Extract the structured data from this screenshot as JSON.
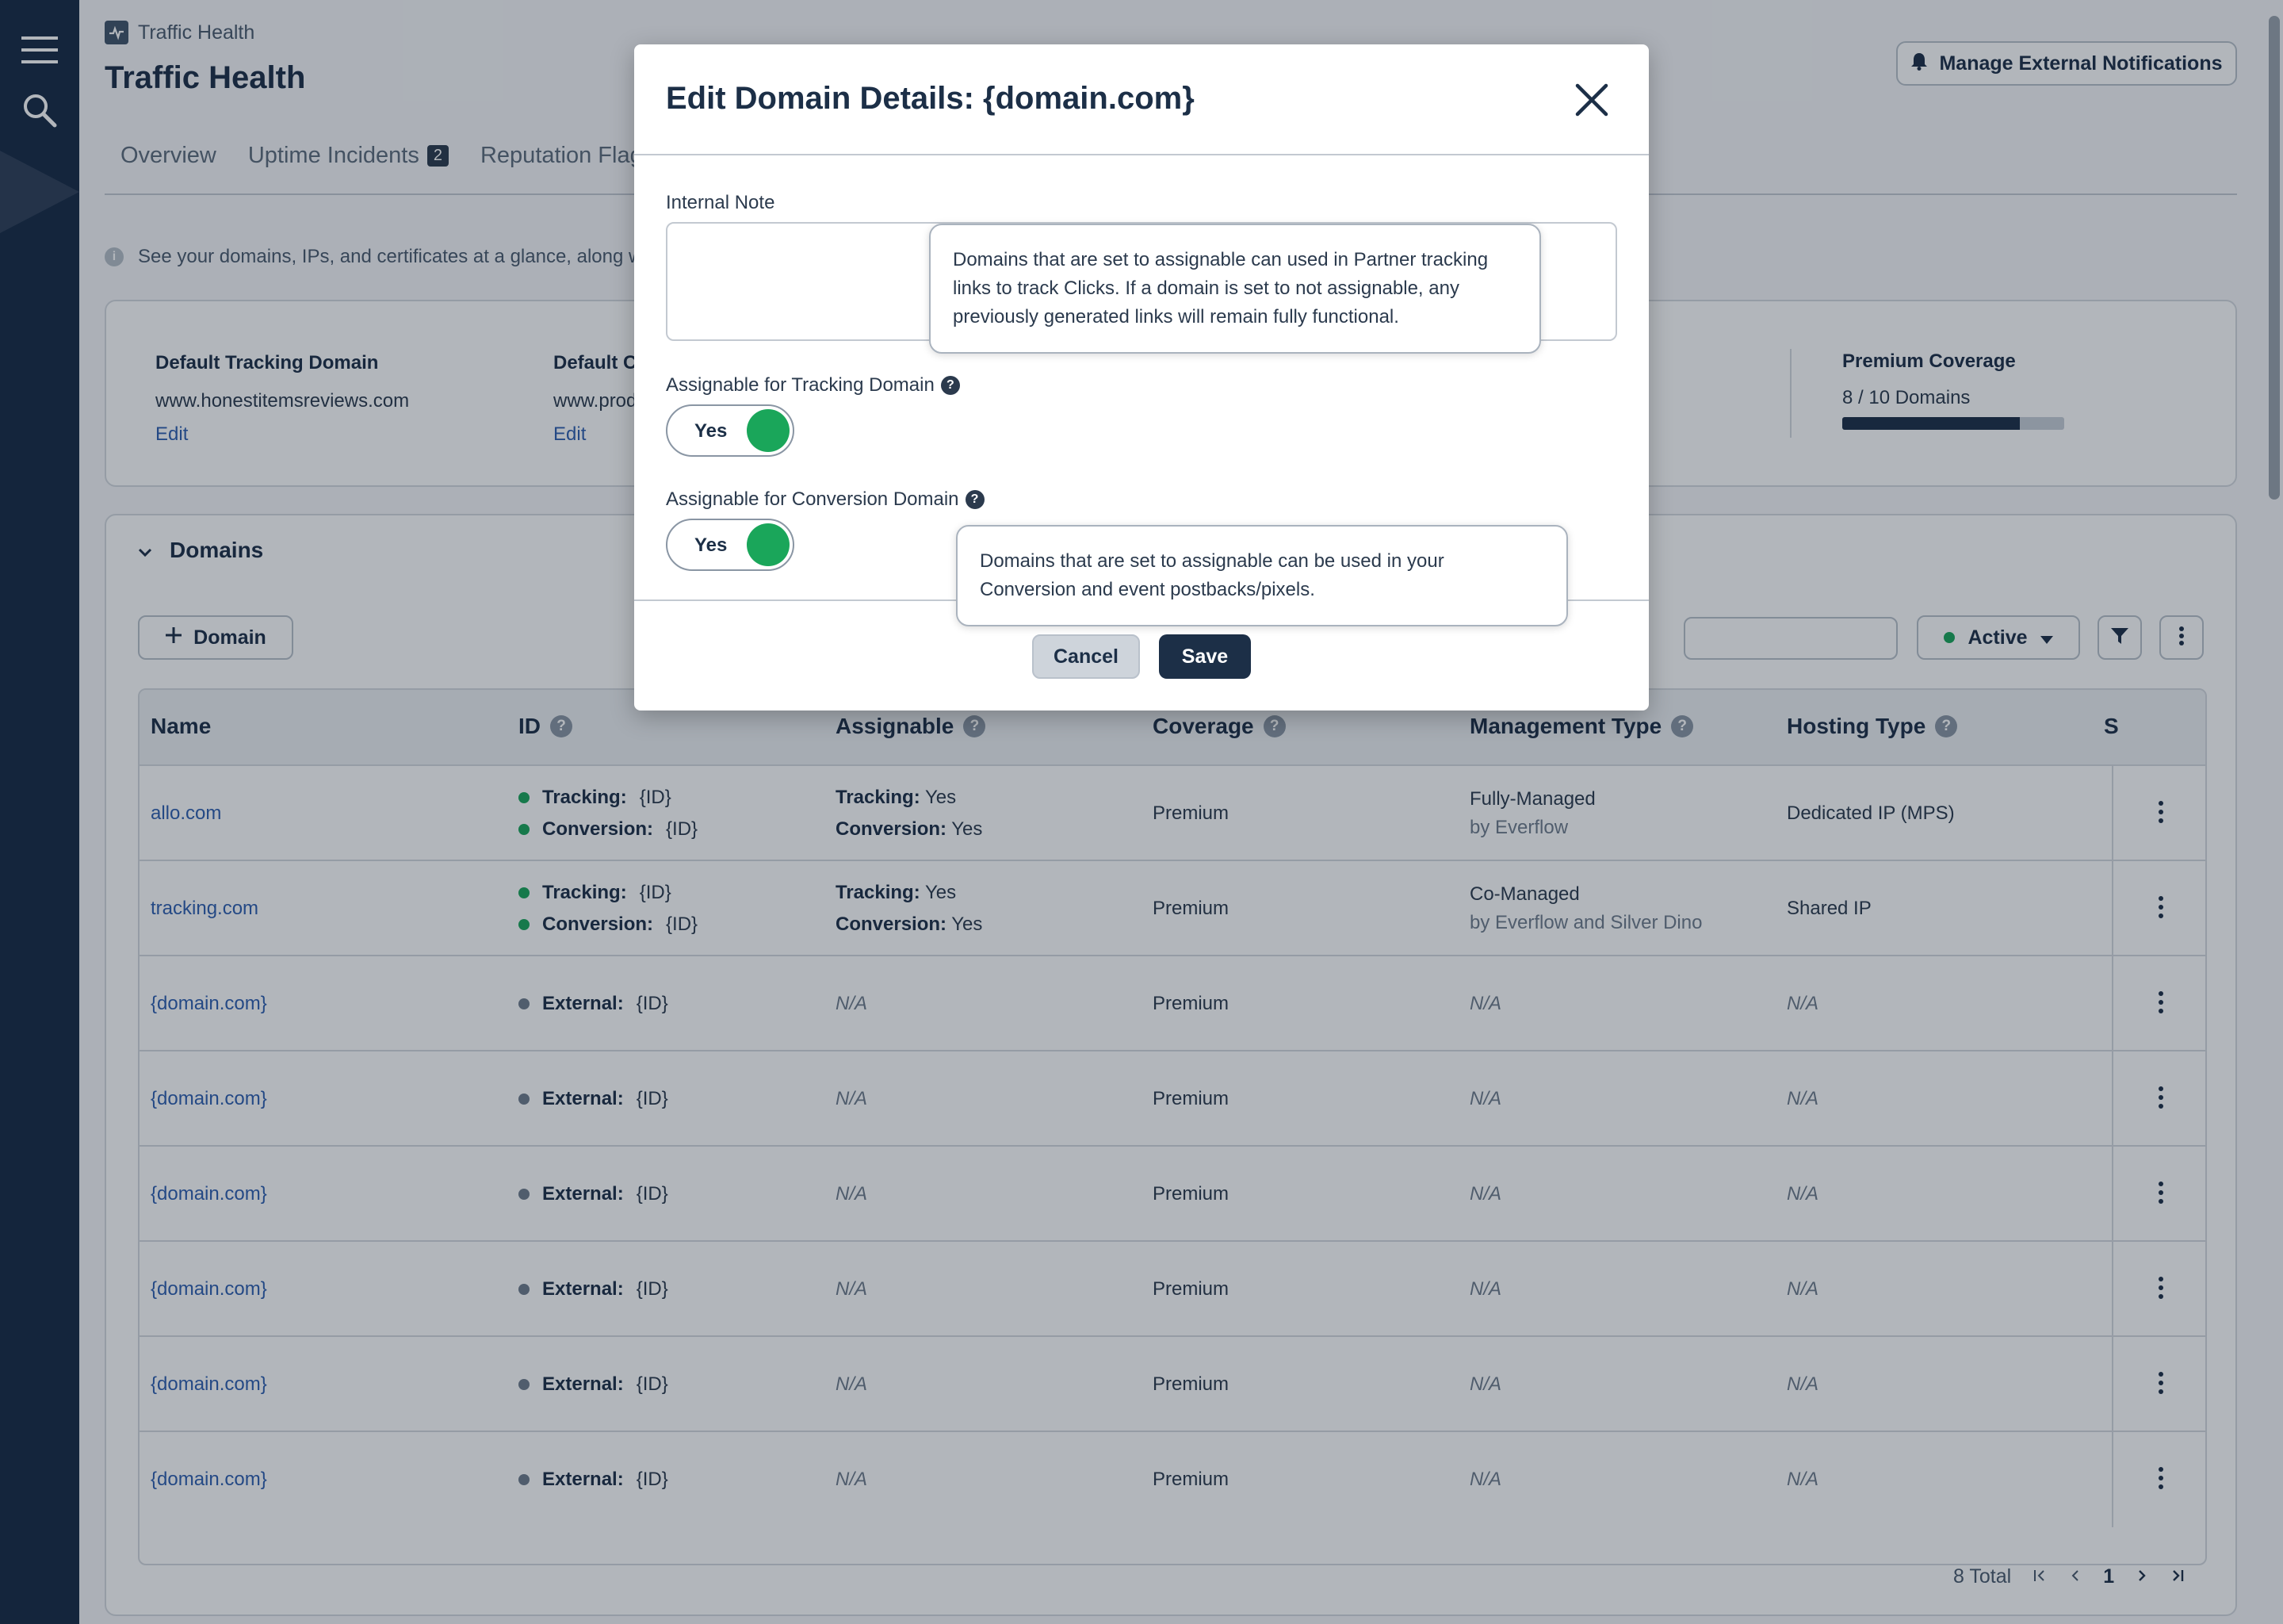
{
  "app": {
    "breadcrumb": "Traffic Health",
    "title": "Traffic Health",
    "manage_notifications": "Manage External Notifications"
  },
  "tabs": [
    {
      "label": "Overview"
    },
    {
      "label": "Uptime Incidents",
      "badge": "2"
    },
    {
      "label": "Reputation Flags"
    }
  ],
  "info_text": "See your domains, IPs, and certificates at a glance, along wit",
  "summary": {
    "tracking": {
      "label": "Default Tracking Domain",
      "value": "www.honestitemsreviews.com",
      "edit": "Edit"
    },
    "conversion": {
      "label": "Default Co",
      "value": "www.prod",
      "edit": "Edit"
    },
    "coverage": {
      "label": "Premium Coverage",
      "value": "8 / 10 Domains",
      "used": 8,
      "total": 10
    }
  },
  "domains": {
    "title": "Domains",
    "add_button": "Domain",
    "status_filter": "Active",
    "columns": [
      "Name",
      "ID",
      "Assignable",
      "Coverage",
      "Management Type",
      "Hosting Type",
      "S"
    ],
    "rows": [
      {
        "name": "allo.com",
        "id1_label": "Tracking:",
        "id1": "{ID}",
        "id2_label": "Conversion:",
        "id2": "{ID}",
        "assign1_label": "Tracking:",
        "assign1": "Yes",
        "assign2_label": "Conversion:",
        "assign2": "Yes",
        "coverage": "Premium",
        "mgmt": "Fully-Managed",
        "mgmt_sub": "by Everflow",
        "hosting": "Dedicated IP (MPS)"
      },
      {
        "name": "tracking.com",
        "id1_label": "Tracking:",
        "id1": "{ID}",
        "id2_label": "Conversion:",
        "id2": "{ID}",
        "assign1_label": "Tracking:",
        "assign1": "Yes",
        "assign2_label": "Conversion:",
        "assign2": "Yes",
        "coverage": "Premium",
        "mgmt": "Co-Managed",
        "mgmt_sub": "by Everflow and Silver Dino",
        "hosting": "Shared IP"
      },
      {
        "name": "{domain.com}",
        "ext_label": "External:",
        "ext": "{ID}",
        "assign": "N/A",
        "coverage": "Premium",
        "mgmt": "N/A",
        "hosting": "N/A"
      },
      {
        "name": "{domain.com}",
        "ext_label": "External:",
        "ext": "{ID}",
        "assign": "N/A",
        "coverage": "Premium",
        "mgmt": "N/A",
        "hosting": "N/A"
      },
      {
        "name": "{domain.com}",
        "ext_label": "External:",
        "ext": "{ID}",
        "assign": "N/A",
        "coverage": "Premium",
        "mgmt": "N/A",
        "hosting": "N/A"
      },
      {
        "name": "{domain.com}",
        "ext_label": "External:",
        "ext": "{ID}",
        "assign": "N/A",
        "coverage": "Premium",
        "mgmt": "N/A",
        "hosting": "N/A"
      },
      {
        "name": "{domain.com}",
        "ext_label": "External:",
        "ext": "{ID}",
        "assign": "N/A",
        "coverage": "Premium",
        "mgmt": "N/A",
        "hosting": "N/A"
      },
      {
        "name": "{domain.com}",
        "ext_label": "External:",
        "ext": "{ID}",
        "assign": "N/A",
        "coverage": "Premium",
        "mgmt": "N/A",
        "hosting": "N/A"
      }
    ],
    "total": "8 Total",
    "page": "1"
  },
  "modal": {
    "title": "Edit Domain Details: {domain.com}",
    "note_label": "Internal Note",
    "tracking_label": "Assignable for Tracking Domain",
    "tracking_value": "Yes",
    "conversion_label": "Assignable for Conversion Domain",
    "conversion_value": "Yes",
    "tooltip_tracking": "Domains that are set to assignable can used in Partner tracking links to track Clicks. If a domain is set to not assignable, any previously generated links will remain fully functional.",
    "tooltip_conversion": "Domains that are set to assignable can be used in your Conversion and event postbacks/pixels.",
    "cancel": "Cancel",
    "save": "Save"
  },
  "colors": {
    "sidebar": "#172a45",
    "primary": "#1c2f47",
    "link": "#2f5fb0",
    "success": "#1aa65a"
  }
}
